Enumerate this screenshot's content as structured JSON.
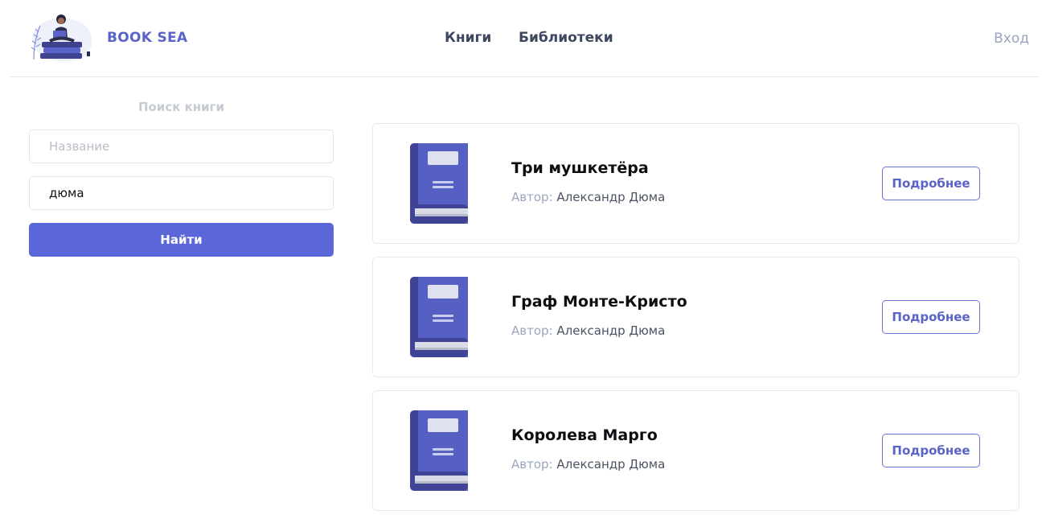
{
  "header": {
    "brand": "BOOK SEA",
    "nav": [
      "Книги",
      "Библиотеки"
    ],
    "login": "Вход"
  },
  "search": {
    "title": "Поиск книги",
    "title_placeholder": "Название",
    "title_value": "",
    "author_value": "дюма",
    "submit_label": "Найти"
  },
  "books": [
    {
      "title": "Три мушкетёра",
      "author_label": "Автор:",
      "author": "Александр Дюма",
      "button": "Подробнее"
    },
    {
      "title": "Граф Монте-Кристо",
      "author_label": "Автор:",
      "author": "Александр Дюма",
      "button": "Подробнее"
    },
    {
      "title": "Королева Марго",
      "author_label": "Автор:",
      "author": "Александр Дюма",
      "button": "Подробнее"
    }
  ],
  "colors": {
    "accent": "#5b67d9",
    "cover": "#5560c2",
    "cover_dark": "#3f4396",
    "muted": "#9aa6bd"
  },
  "icons": {
    "logo": "reading-person-books-illustration",
    "book": "book-cover-icon"
  }
}
